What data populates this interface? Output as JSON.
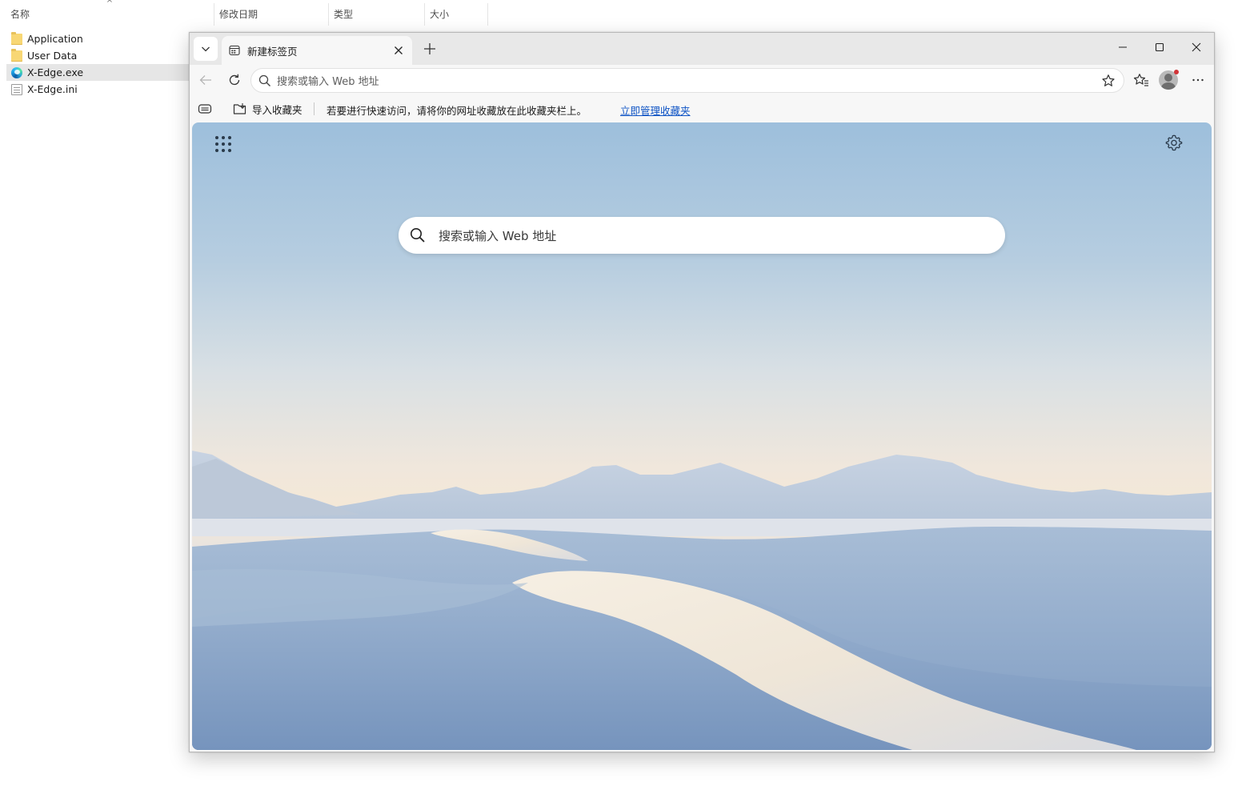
{
  "explorer": {
    "columns": {
      "name": "名称",
      "modified": "修改日期",
      "type": "类型",
      "size": "大小"
    },
    "sort_indicator": "^",
    "files": [
      {
        "name": "Application",
        "icon": "folder-icon"
      },
      {
        "name": "User Data",
        "icon": "folder-icon"
      },
      {
        "name": "X-Edge.exe",
        "icon": "edge-app-icon",
        "selected": true
      },
      {
        "name": "X-Edge.ini",
        "icon": "ini-file-icon"
      }
    ]
  },
  "browser": {
    "tab": {
      "title": "新建标签页",
      "favicon": "new-tab-page-icon"
    },
    "address_bar": {
      "placeholder": "搜索或输入 Web 地址"
    },
    "favorites_bar": {
      "import_label": "导入收藏夹",
      "hint": "若要进行快速访问，请将你的网址收藏放在此收藏夹栏上。",
      "manage_link": "立即管理收藏夹"
    },
    "new_tab_page": {
      "search_placeholder": "搜索或输入 Web 地址"
    }
  }
}
